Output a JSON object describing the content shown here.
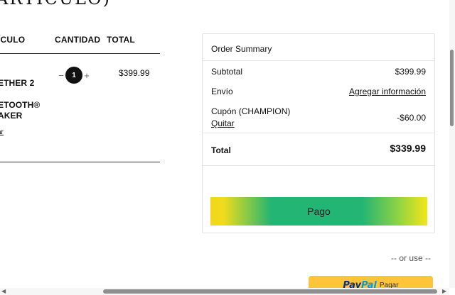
{
  "page": {
    "heading": "ARTÍCULO)"
  },
  "cart": {
    "headers": {
      "item": "ÍCULO",
      "quantity": "CANTIDAD",
      "total": "TOTAL"
    },
    "item": {
      "name_lines": [
        "ETHER 2",
        "ETOOTH®",
        "AKER"
      ],
      "remove": "ar",
      "quantity": "1",
      "quantity_minus": "−",
      "quantity_plus": "+",
      "line_total": "$399.99"
    }
  },
  "summary": {
    "title": "Order Summary",
    "subtotal_label": "Subtotal",
    "subtotal_value": "$399.99",
    "shipping_label": "Envío",
    "shipping_action": "Agregar información",
    "coupon_label": "Cupón (CHAMPION)",
    "coupon_remove": "Quitar",
    "coupon_value": "-$60.00",
    "total_label": "Total",
    "total_value": "$339.99",
    "checkout_label": "Pago"
  },
  "alt_payment": {
    "or_use": "-- or use --",
    "paypal_pay": "Pay",
    "paypal_pal": "Pal",
    "paypal_label": "Pagar"
  },
  "scrollbars": {
    "left_arrow": "◀",
    "right_arrow": "▶"
  },
  "colors": {
    "checkout_gradient_edge": "#f1d71a",
    "checkout_gradient_center": "#22b573",
    "paypal_yellow": "#ffc439",
    "paypal_dark_blue": "#003087",
    "paypal_light_blue": "#009cde"
  }
}
